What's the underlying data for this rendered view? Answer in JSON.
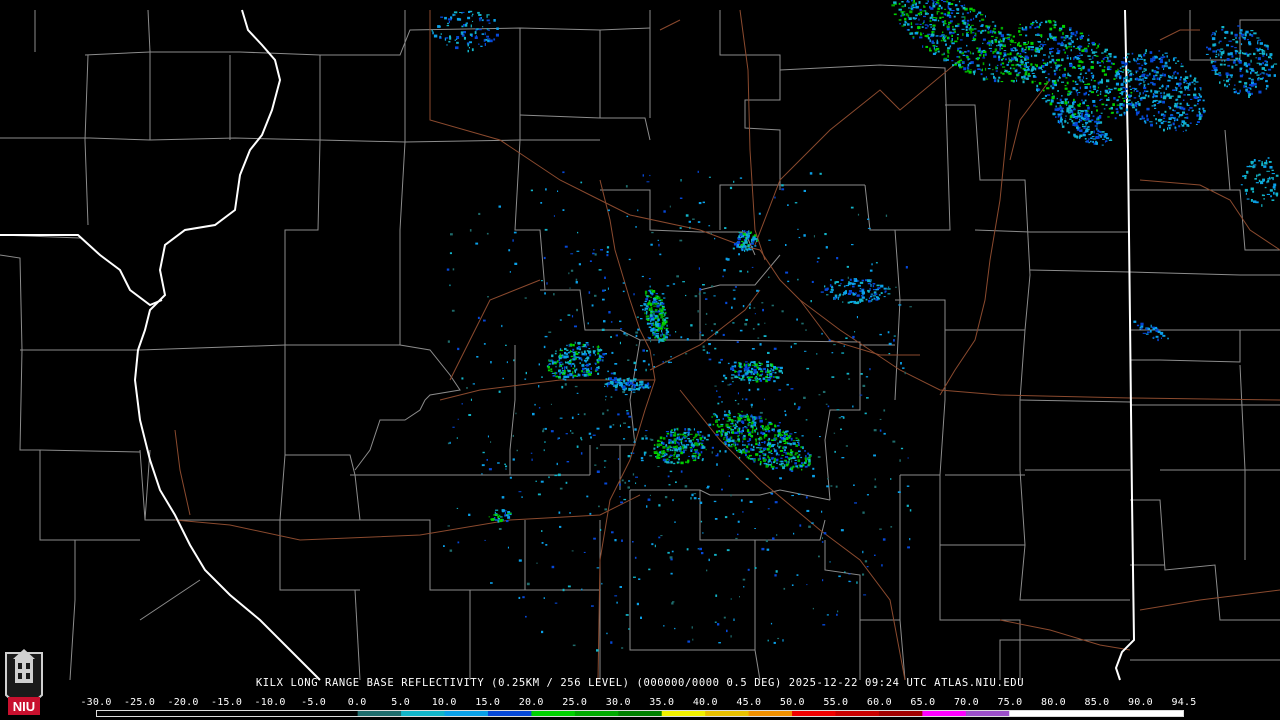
{
  "caption": "KILX LONG RANGE BASE REFLECTIVITY (0.25KM / 256 LEVEL) (000000/0000 0.5 DEG) 2025-12-22 09:24 UTC  ATLAS.NIU.EDU",
  "logo": {
    "text": "NIU",
    "name": "niu-logo"
  },
  "colorscale": {
    "labels": [
      "-30.0",
      "-25.0",
      "-20.0",
      "-15.0",
      "-10.0",
      "-5.0",
      "0.0",
      "5.0",
      "10.0",
      "15.0",
      "20.0",
      "25.0",
      "30.0",
      "35.0",
      "40.0",
      "45.0",
      "50.0",
      "55.0",
      "60.0",
      "65.0",
      "70.0",
      "75.0",
      "80.0",
      "85.0",
      "90.0",
      "94.5"
    ],
    "colors": [
      "#000000",
      "#000000",
      "#000000",
      "#000000",
      "#000000",
      "#000000",
      "#1e6c6c",
      "#12b4c8",
      "#0aa0e8",
      "#0648d8",
      "#00d000",
      "#00a800",
      "#008000",
      "#f0f000",
      "#e8c000",
      "#f09000",
      "#f00000",
      "#c80000",
      "#a00000",
      "#ff00ff",
      "#9c50c8",
      "#ffffff",
      "#ffffff",
      "#ffffff",
      "#ffffff"
    ]
  },
  "colors": {
    "background": "#000000",
    "county_line": "#8c8c8c",
    "state_line": "#ffffff",
    "highway": "#8b4a2e"
  }
}
